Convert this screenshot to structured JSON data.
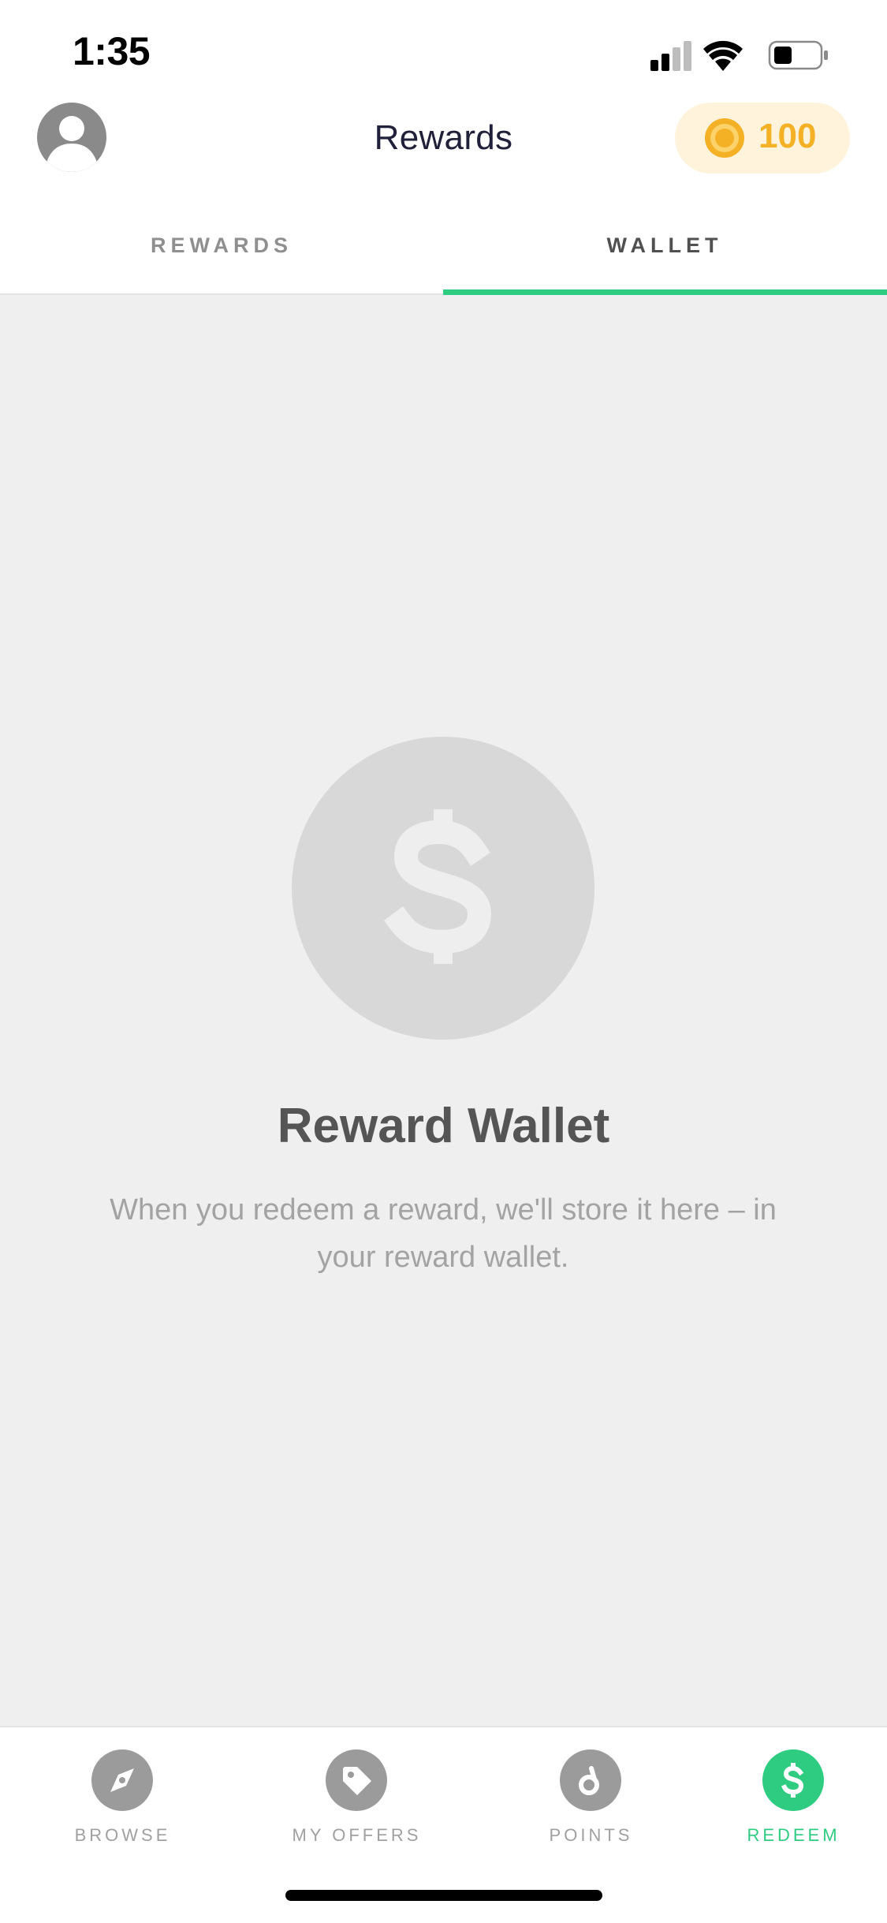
{
  "status_bar": {
    "time": "1:35"
  },
  "header": {
    "title": "Rewards",
    "points": "100",
    "icons": {
      "avatar": "user-avatar-icon",
      "coin": "coin-icon"
    }
  },
  "tabs": [
    {
      "label": "REWARDS",
      "selected": false
    },
    {
      "label": "WALLET",
      "selected": true
    }
  ],
  "empty_state": {
    "icon": "dollar-icon",
    "title": "Reward Wallet",
    "description": "When you redeem a reward, we'll store it here – in your reward wallet."
  },
  "bottom_nav": [
    {
      "label": "BROWSE",
      "icon": "compass-icon",
      "active": false
    },
    {
      "label": "MY OFFERS",
      "icon": "tag-icon",
      "active": false
    },
    {
      "label": "POINTS",
      "icon": "points-icon",
      "active": false
    },
    {
      "label": "REDEEM",
      "icon": "dollar-icon",
      "active": true
    }
  ],
  "colors": {
    "accent": "#2ecc80",
    "points": "#f4b125",
    "points_bg": "#fff3dc",
    "content_bg": "#efefef"
  }
}
